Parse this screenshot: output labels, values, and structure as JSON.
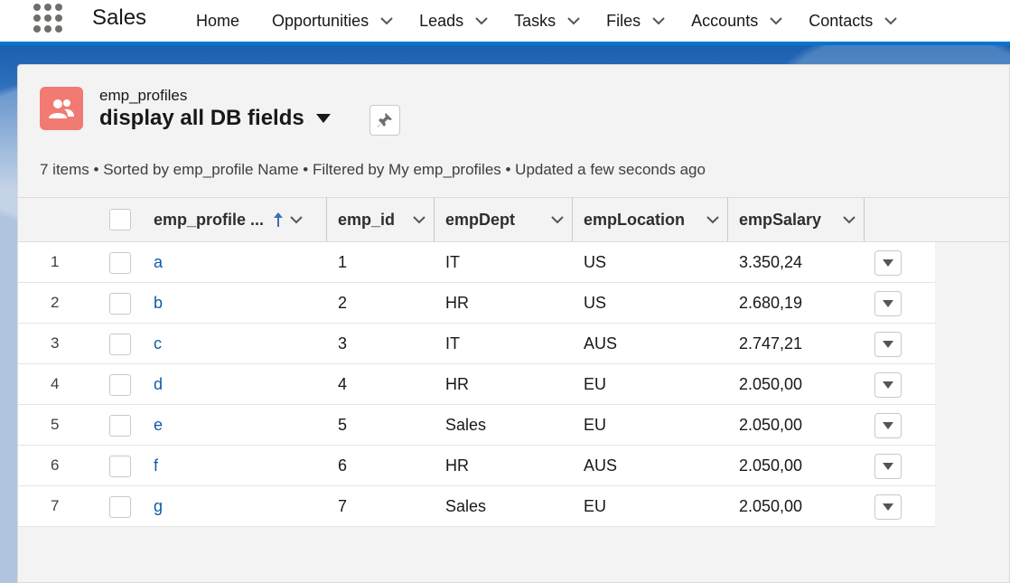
{
  "app": {
    "name": "Sales"
  },
  "nav": [
    {
      "label": "Home",
      "has_menu": false
    },
    {
      "label": "Opportunities",
      "has_menu": true
    },
    {
      "label": "Leads",
      "has_menu": true
    },
    {
      "label": "Tasks",
      "has_menu": true
    },
    {
      "label": "Files",
      "has_menu": true
    },
    {
      "label": "Accounts",
      "has_menu": true
    },
    {
      "label": "Contacts",
      "has_menu": true
    }
  ],
  "header": {
    "object_label": "emp_profiles",
    "list_view_name": "display all DB fields",
    "icon": "user-group-icon",
    "icon_color": "#f17a73",
    "meta": "7 items • Sorted by emp_profile Name • Filtered by My emp_profiles • Updated a few seconds ago"
  },
  "columns": [
    {
      "label": "emp_profile ...",
      "sorted": "asc"
    },
    {
      "label": "emp_id"
    },
    {
      "label": "empDept"
    },
    {
      "label": "empLocation"
    },
    {
      "label": "empSalary"
    }
  ],
  "rows": [
    {
      "num": "1",
      "name": "a",
      "id": "1",
      "dept": "IT",
      "location": "US",
      "salary": "3.350,24"
    },
    {
      "num": "2",
      "name": "b",
      "id": "2",
      "dept": "HR",
      "location": "US",
      "salary": "2.680,19"
    },
    {
      "num": "3",
      "name": "c",
      "id": "3",
      "dept": "IT",
      "location": "AUS",
      "salary": "2.747,21"
    },
    {
      "num": "4",
      "name": "d",
      "id": "4",
      "dept": "HR",
      "location": "EU",
      "salary": "2.050,00"
    },
    {
      "num": "5",
      "name": "e",
      "id": "5",
      "dept": "Sales",
      "location": "EU",
      "salary": "2.050,00"
    },
    {
      "num": "6",
      "name": "f",
      "id": "6",
      "dept": "HR",
      "location": "AUS",
      "salary": "2.050,00"
    },
    {
      "num": "7",
      "name": "g",
      "id": "7",
      "dept": "Sales",
      "location": "EU",
      "salary": "2.050,00"
    }
  ],
  "colors": {
    "accent": "#0176d3",
    "link": "#0b5cab"
  }
}
